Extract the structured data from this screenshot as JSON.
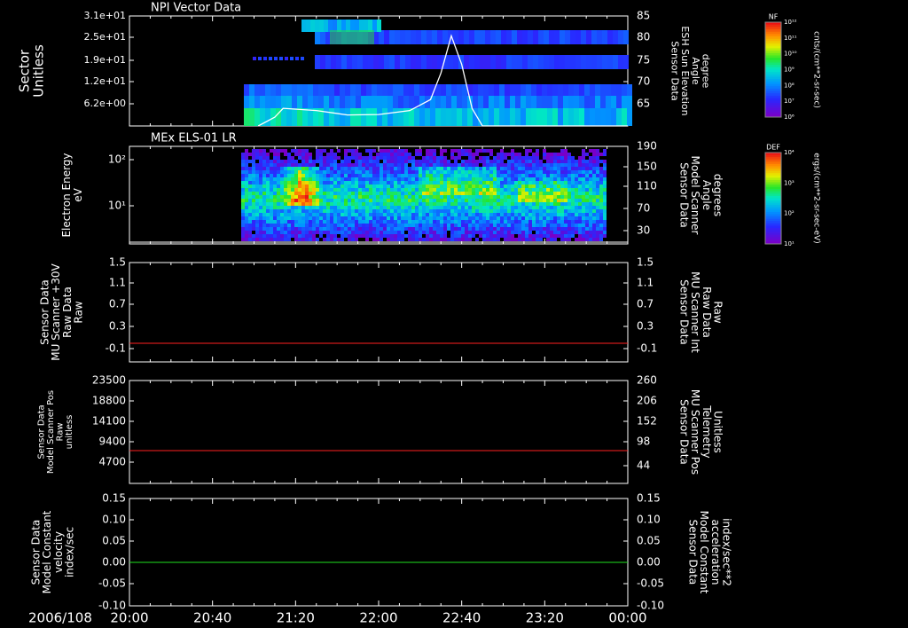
{
  "chart_data": [
    {
      "type": "heatmap",
      "title": "NPI Vector Data",
      "ylabel": "Sector\nUnitless",
      "yticks": [
        "3.1e+01",
        "2.5e+01",
        "1.9e+01",
        "1.2e+01",
        "6.2e+00"
      ],
      "right_ylabel": "Sensor Data\nESH Sun Elevation\nAngle\ndegree",
      "right_yticks": [
        "85",
        "80",
        "75",
        "70",
        "65"
      ],
      "right_ylim": [
        60,
        85
      ],
      "overlay_line": {
        "color": "#ffffff",
        "x": [
          "21:02",
          "21:10",
          "21:14",
          "21:30",
          "21:45",
          "22:00",
          "22:15",
          "22:25",
          "22:30",
          "22:35",
          "22:40",
          "22:45",
          "22:50",
          "23:00",
          "00:00"
        ],
        "y": [
          60,
          62,
          64,
          63.5,
          62.5,
          62.6,
          63.5,
          66,
          72,
          80.5,
          74,
          64,
          60,
          60,
          60
        ]
      },
      "colorbar": {
        "label": "NF",
        "unit": "cnts/(cm**2-sr-sec)",
        "ticks": [
          "10¹²",
          "10¹¹",
          "10¹⁰",
          "10⁹",
          "10⁸",
          "10⁷",
          "10⁶"
        ]
      }
    },
    {
      "type": "heatmap",
      "title": "MEx ELS-01 LR",
      "ylabel": "Electron Energy\neV",
      "yticks": [
        "10²",
        "10¹"
      ],
      "right_ylabel": "Sensor Data\nModel Scanner\nAngle\ndegrees",
      "right_yticks": [
        "190",
        "150",
        "110",
        "70",
        "30"
      ],
      "right_ylim": [
        0,
        190
      ],
      "overlay_line": {
        "color": "#ffffff",
        "x": [
          "20:00",
          "00:00"
        ],
        "y": [
          10,
          10
        ]
      },
      "colorbar": {
        "label": "DEF",
        "unit": "ergs/(cm**2-sr-sec-eV)",
        "ticks": [
          "10⁴",
          "10³",
          "10²",
          "10¹"
        ]
      }
    },
    {
      "type": "line",
      "ylabel": "Sensor Data\nMU Scanner +30V\nRaw Data\nRaw",
      "yticks": [
        "1.5",
        "1.1",
        "0.7",
        "0.3",
        "-0.1"
      ],
      "ylim": [
        -0.3,
        1.5
      ],
      "right_ylabel": "Sensor Data\nMU Scanner Int\nRaw Data\nRaw",
      "right_ylabel_color": "#ff2020",
      "right_yticks": [
        "1.5",
        "1.1",
        "0.7",
        "0.3",
        "-0.1"
      ],
      "series": [
        {
          "color": "#ff2020",
          "x": [
            "20:00",
            "00:00"
          ],
          "y": [
            0.0,
            0.0
          ]
        }
      ]
    },
    {
      "type": "line",
      "ylabel": "Sensor Data\nModel Scanner Pos\nRaw\nunitless",
      "yticks": [
        "23500",
        "18800",
        "14100",
        "9400",
        "4700"
      ],
      "ylim": [
        0,
        23500
      ],
      "right_ylabel": "Sensor Data\nMU Scanner Pos\nTelemetry\nUnitless",
      "right_ylabel_color": "#ff2020",
      "right_yticks": [
        "260",
        "206",
        "152",
        "98",
        "44"
      ],
      "series": [
        {
          "color": "#ff2020",
          "x": [
            "20:00",
            "00:00"
          ],
          "y": [
            8000,
            8000
          ]
        }
      ]
    },
    {
      "type": "line",
      "ylabel": "Sensor Data\nModel Constant\nvelocity\nindex/sec",
      "yticks": [
        "0.15",
        "0.10",
        "0.05",
        "0.00",
        "-0.05",
        "-0.10"
      ],
      "ylim": [
        -0.1,
        0.15
      ],
      "right_ylabel": "Sensor Data\nModel Constant\nacceleration\nindex/sec**2",
      "right_ylabel_color": "#20e020",
      "right_yticks": [
        "0.15",
        "0.10",
        "0.05",
        "0.00",
        "-0.05",
        "-0.10"
      ],
      "series": [
        {
          "color": "#20e020",
          "x": [
            "20:00",
            "00:00"
          ],
          "y": [
            0.0,
            0.0
          ]
        }
      ]
    }
  ],
  "xaxis": {
    "date_label": "2006/108",
    "ticks": [
      "20:00",
      "20:40",
      "21:20",
      "22:00",
      "22:40",
      "23:20",
      "00:00"
    ]
  }
}
